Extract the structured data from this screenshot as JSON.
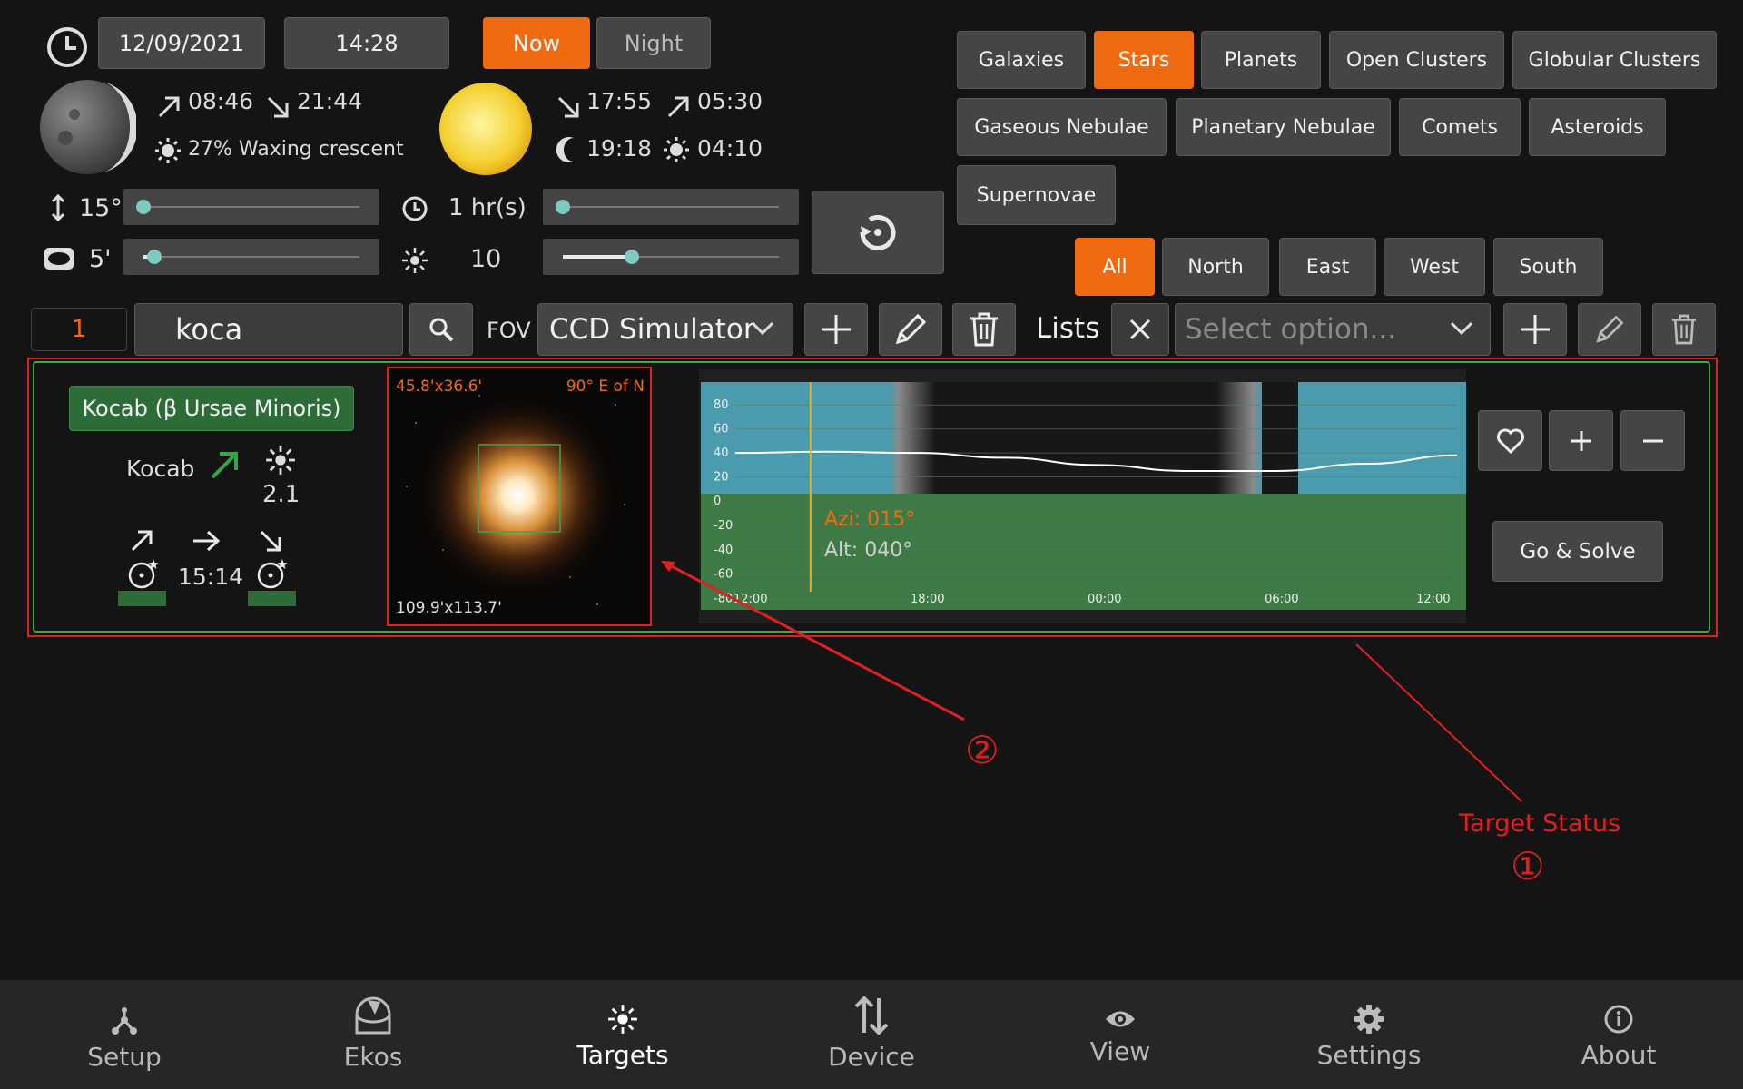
{
  "top": {
    "date": "12/09/2021",
    "time": "14:28",
    "now_label": "Now",
    "night_label": "Night"
  },
  "moon": {
    "rise": "08:46",
    "set": "21:44",
    "phase": "27% Waxing crescent"
  },
  "sun": {
    "set": "17:55",
    "rise": "05:30",
    "dusk": "19:18",
    "dawn": "04:10"
  },
  "filters": {
    "min_alt": "15°",
    "duration": "1 hr(s)",
    "min_size": "5'",
    "magnitude": "10",
    "min_alt_level": 0.0,
    "duration_level": 0.0,
    "min_size_level": 0.05,
    "magnitude_level": 0.32
  },
  "categories": [
    "Galaxies",
    "Stars",
    "Planets",
    "Open Clusters",
    "Globular Clusters",
    "Gaseous Nebulae",
    "Planetary Nebulae",
    "Comets",
    "Asteroids",
    "Supernovae"
  ],
  "active_category": "Stars",
  "directions": [
    "All",
    "North",
    "East",
    "West",
    "South"
  ],
  "active_direction": "All",
  "search": {
    "count": "1",
    "query": "koca",
    "fov_label": "FOV",
    "camera": "CCD Simulator",
    "lists_label": "Lists",
    "lists_placeholder": "Select option..."
  },
  "target": {
    "full_name": "Kocab (β Ursae Minoris)",
    "name": "Kocab",
    "magnitude": "2.1",
    "transit_time": "15:14",
    "fov_size": "45.8'x36.6'",
    "rotation": "90° E of N",
    "image_size": "109.9'x113.7'",
    "azimuth": "Azi: 015°",
    "altitude": "Alt:  040°",
    "go_label": "Go & Solve"
  },
  "chart_data": {
    "type": "line",
    "title": "",
    "x_ticks": [
      "12:00",
      "18:00",
      "00:00",
      "06:00",
      "12:00"
    ],
    "y_ticks": [
      "80",
      "60",
      "40",
      "20",
      "0",
      "-20",
      "-40",
      "-60",
      "-80"
    ],
    "ylim": [
      -90,
      90
    ],
    "series": [
      {
        "x": [
          0,
          3,
          6,
          9,
          12,
          15,
          18,
          21,
          24
        ],
        "y": [
          40,
          41,
          40,
          36,
          30,
          25,
          25,
          31,
          38
        ]
      }
    ],
    "current_time_x": 2.5
  },
  "annotations": {
    "label_1": "Target Status",
    "num_1": "①",
    "num_2": "②"
  },
  "nav": [
    {
      "label": "Setup",
      "icon": "setup-icon"
    },
    {
      "label": "Ekos",
      "icon": "ekos-icon"
    },
    {
      "label": "Targets",
      "icon": "targets-icon"
    },
    {
      "label": "Device",
      "icon": "device-icon"
    },
    {
      "label": "View",
      "icon": "view-icon"
    },
    {
      "label": "Settings",
      "icon": "settings-icon"
    },
    {
      "label": "About",
      "icon": "about-icon"
    }
  ],
  "colors": {
    "accent": "#f06a12",
    "sky_day": "#4a9bad",
    "ground": "#3d7a45",
    "annotation": "#e02020"
  }
}
